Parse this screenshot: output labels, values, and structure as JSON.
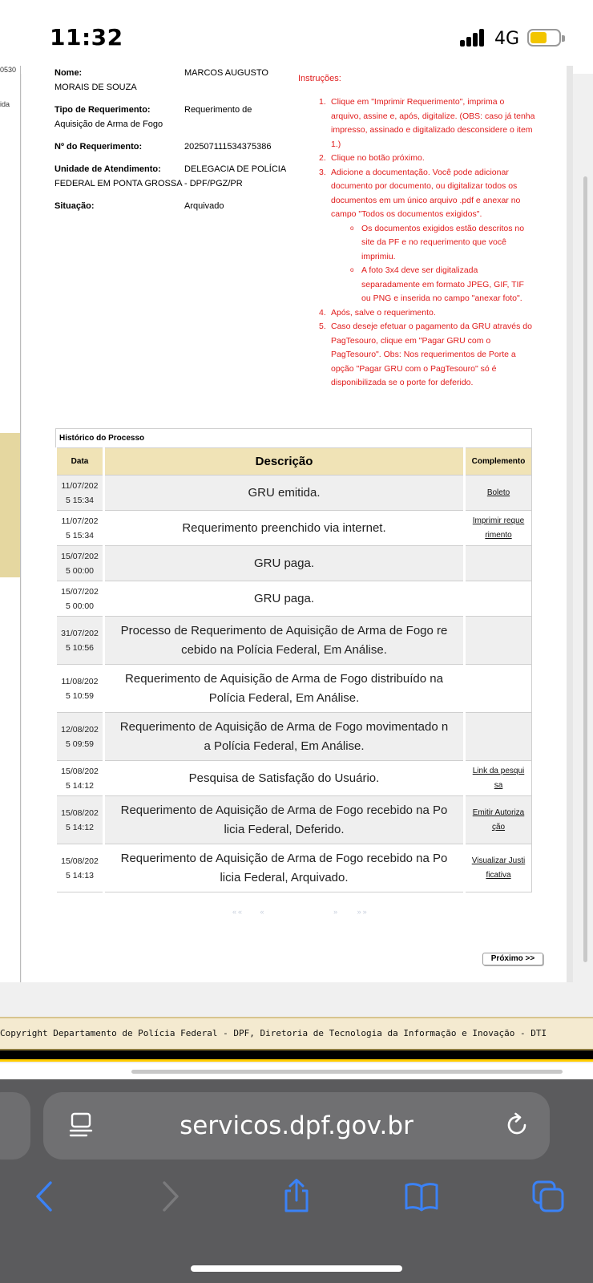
{
  "status": {
    "time": "11:32",
    "network": "4G"
  },
  "left_strip": {
    "text1": "ida",
    "text2": "0530"
  },
  "requerimento": {
    "nome_label": "Nome:",
    "nome_value_1": "MARCOS AUGUSTO",
    "nome_value_2": "MORAIS DE SOUZA",
    "tipo_label": "Tipo de Requerimento:",
    "tipo_value_1": "Requerimento de",
    "tipo_value_2": "Aquisição de Arma de Fogo",
    "numero_label": "Nº do Requerimento:",
    "numero_value": "202507111534375386",
    "unidade_label": "Unidade de Atendimento:",
    "unidade_value_1": "DELEGACIA DE POLÍCIA",
    "unidade_value_2": "FEDERAL EM PONTA GROSSA - DPF/PGZ/PR",
    "situacao_label": "Situação:",
    "situacao_value": "Arquivado"
  },
  "instrucoes": {
    "title": "Instruções:",
    "items": [
      {
        "num": "1.",
        "text": "Clique em \"Imprimir Requerimento\", imprima o arquivo, assine e, após, digitalize. (OBS: caso já tenha impresso, assinado e digitalizado desconsidere o item 1.)"
      },
      {
        "num": "2.",
        "text": "Clique no botão próximo."
      },
      {
        "num": "3.",
        "text": "Adicione a documentação. Você pode adicionar documento por documento, ou digitalizar todos os documentos em um único arquivo .pdf e anexar no campo \"Todos os documentos exigidos\"."
      },
      {
        "num": "4.",
        "text": "Após, salve o requerimento."
      },
      {
        "num": "5.",
        "text": "Caso deseje efetuar o pagamento da GRU através do PagTesouro, clique em \"Pagar GRU com o PagTesouro\". Obs: Nos requerimentos de Porte a opção \"Pagar GRU com o PagTesouro\" só é disponibilizada se o porte for deferido."
      }
    ],
    "subitems": [
      "Os documentos exigidos estão descritos no site da PF e no requerimento que você imprimiu.",
      "A foto 3x4 deve ser digitalizada separadamente em formato JPEG, GIF, TIF ou PNG e inserida no campo \"anexar foto\"."
    ]
  },
  "historico": {
    "title": "Histórico do Processo",
    "col_data": "Data",
    "col_descricao": "Descrição",
    "col_complemento": "Complemento",
    "rows": [
      {
        "date1": "11/07/202",
        "date2": "5 15:34",
        "desc1": "GRU emitida.",
        "desc2": "",
        "comp1": "Boleto",
        "comp2": ""
      },
      {
        "date1": "11/07/202",
        "date2": "5 15:34",
        "desc1": "Requerimento preenchido via internet.",
        "desc2": "",
        "comp1": "Imprimir reque",
        "comp2": "rimento"
      },
      {
        "date1": "15/07/202",
        "date2": "5 00:00",
        "desc1": "GRU paga.",
        "desc2": "",
        "comp1": "",
        "comp2": ""
      },
      {
        "date1": "15/07/202",
        "date2": "5 00:00",
        "desc1": "GRU paga.",
        "desc2": "",
        "comp1": "",
        "comp2": ""
      },
      {
        "date1": "31/07/202",
        "date2": "5 10:56",
        "desc1": "Processo de Requerimento de Aquisição de Arma de Fogo re",
        "desc2": "cebido na Polícia Federal, Em Análise.",
        "comp1": "",
        "comp2": ""
      },
      {
        "date1": "11/08/202",
        "date2": "5 10:59",
        "desc1": "Requerimento de Aquisição de Arma de Fogo distribuído na",
        "desc2": "Polícia Federal, Em Análise.",
        "comp1": "",
        "comp2": ""
      },
      {
        "date1": "12/08/202",
        "date2": "5 09:59",
        "desc1": "Requerimento de Aquisição de Arma de Fogo movimentado n",
        "desc2": "a Polícia Federal, Em Análise.",
        "comp1": "",
        "comp2": ""
      },
      {
        "date1": "15/08/202",
        "date2": "5 14:12",
        "desc1": "Pesquisa de Satisfação do Usuário.",
        "desc2": "",
        "comp1": "Link da pesqui",
        "comp2": "sa"
      },
      {
        "date1": "15/08/202",
        "date2": "5 14:12",
        "desc1": "Requerimento de Aquisição de Arma de Fogo recebido na Po",
        "desc2": "licia Federal, Deferido.",
        "comp1": "Emitir Autoriza",
        "comp2": "ção"
      },
      {
        "date1": "15/08/202",
        "date2": "5 14:13",
        "desc1": "Requerimento de Aquisição de Arma de Fogo recebido na Po",
        "desc2": "licia Federal, Arquivado.",
        "comp1": "Visualizar Justi",
        "comp2": "ficativa"
      }
    ],
    "pager_first": "««",
    "pager_prev": "«",
    "pager_next": "»",
    "pager_last": "»»"
  },
  "next_button": "Próximo >>",
  "footer": "Copyright Departamento de Polícia Federal - DPF, Diretoria de Tecnologia da Informação e Inovação - DTI",
  "browser": {
    "url": "servicos.dpf.gov.br"
  },
  "colors": {
    "instructions": "#e01b1b",
    "table_header": "#f0e3b6",
    "chrome_bg": "#5b5b5d",
    "ios_blue": "#3b82f6"
  }
}
